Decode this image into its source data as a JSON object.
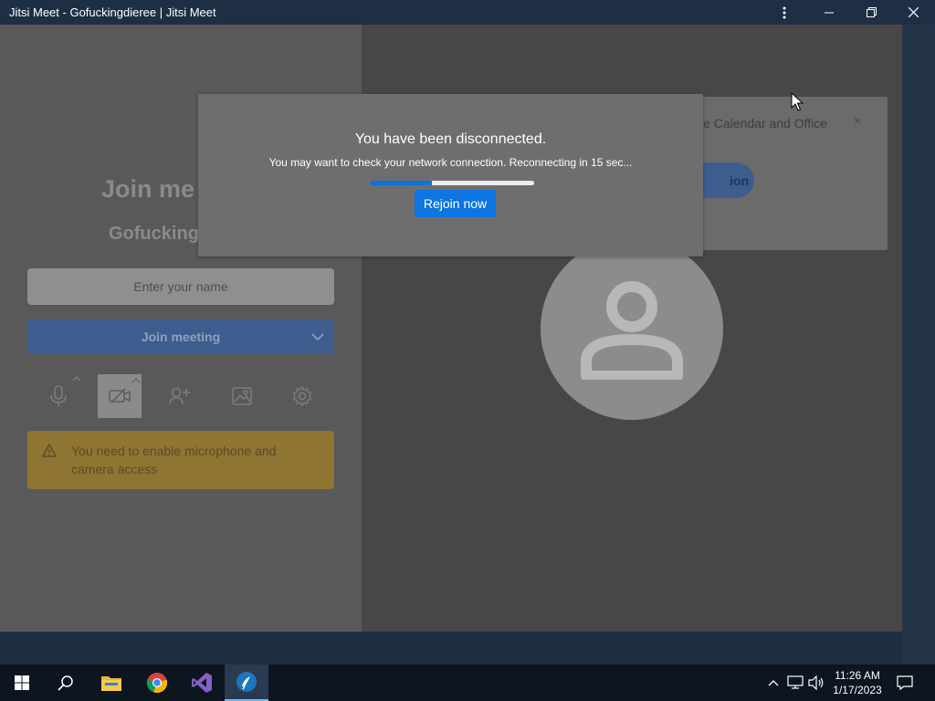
{
  "window": {
    "title": "Jitsi Meet - Gofuckingdieree | Jitsi Meet",
    "menu_icon": "more-vertical-icon",
    "minimize_icon": "minimize-icon",
    "restore_icon": "restore-icon",
    "close_icon": "close-icon"
  },
  "prejoin": {
    "title": "Join me",
    "meeting_name": "Gofucking",
    "name_input_placeholder": "Enter your name",
    "join_label": "Join meeting",
    "tools": [
      "microphone-icon",
      "camera-off-icon",
      "invite-icon",
      "background-icon",
      "settings-icon"
    ],
    "warning_text": "You need to enable microphone and camera access"
  },
  "notification": {
    "text": "le Calendar and Office",
    "close_label": "×",
    "button_label": "ion"
  },
  "dialog": {
    "title": "You have been disconnected.",
    "message": "You may want to check your network connection. Reconnecting in 15 sec...",
    "progress": 0.38,
    "rejoin_label": "Rejoin now"
  },
  "taskbar": {
    "items": [
      "windows-start-icon",
      "search-icon",
      "file-explorer-icon",
      "chrome-icon",
      "visual-studio-icon",
      "jitsi-app-icon"
    ],
    "time": "11:26 AM",
    "date": "1/17/2023"
  },
  "colors": {
    "accent": "#0d76e0",
    "titlebar": "#1e2f45",
    "taskbar": "#0c1520"
  }
}
